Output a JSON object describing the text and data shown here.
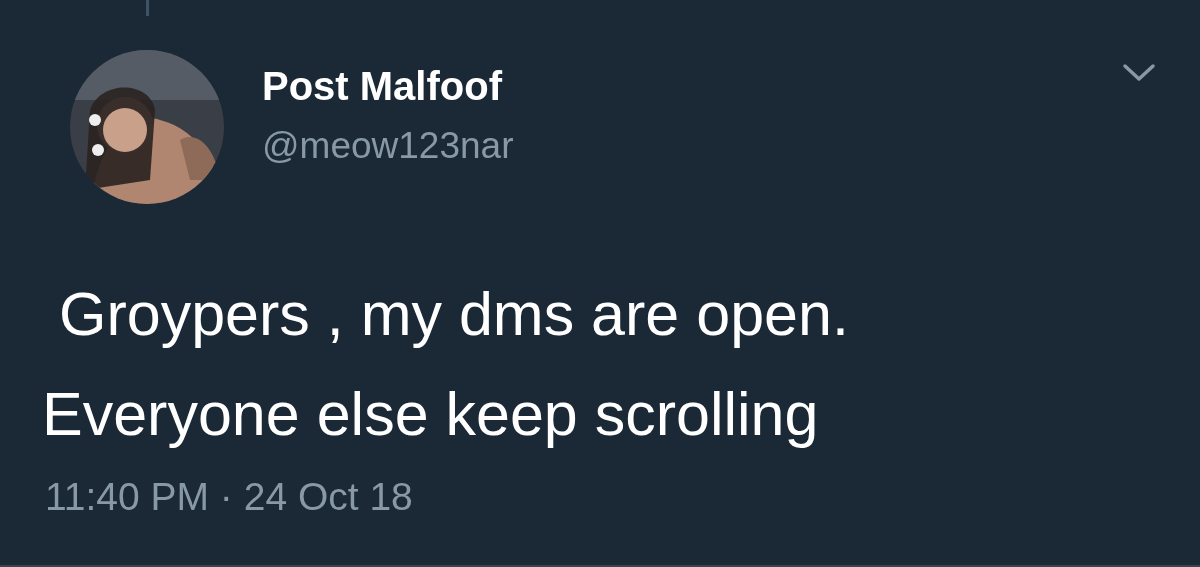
{
  "tweet": {
    "author": {
      "name": "Post Malfoof",
      "handle": "@meow123nar"
    },
    "text_lines": [
      " Groypers , my dms are open.",
      "Everyone else keep scrolling"
    ],
    "timestamp": "11:40 PM · 24 Oct 18"
  }
}
